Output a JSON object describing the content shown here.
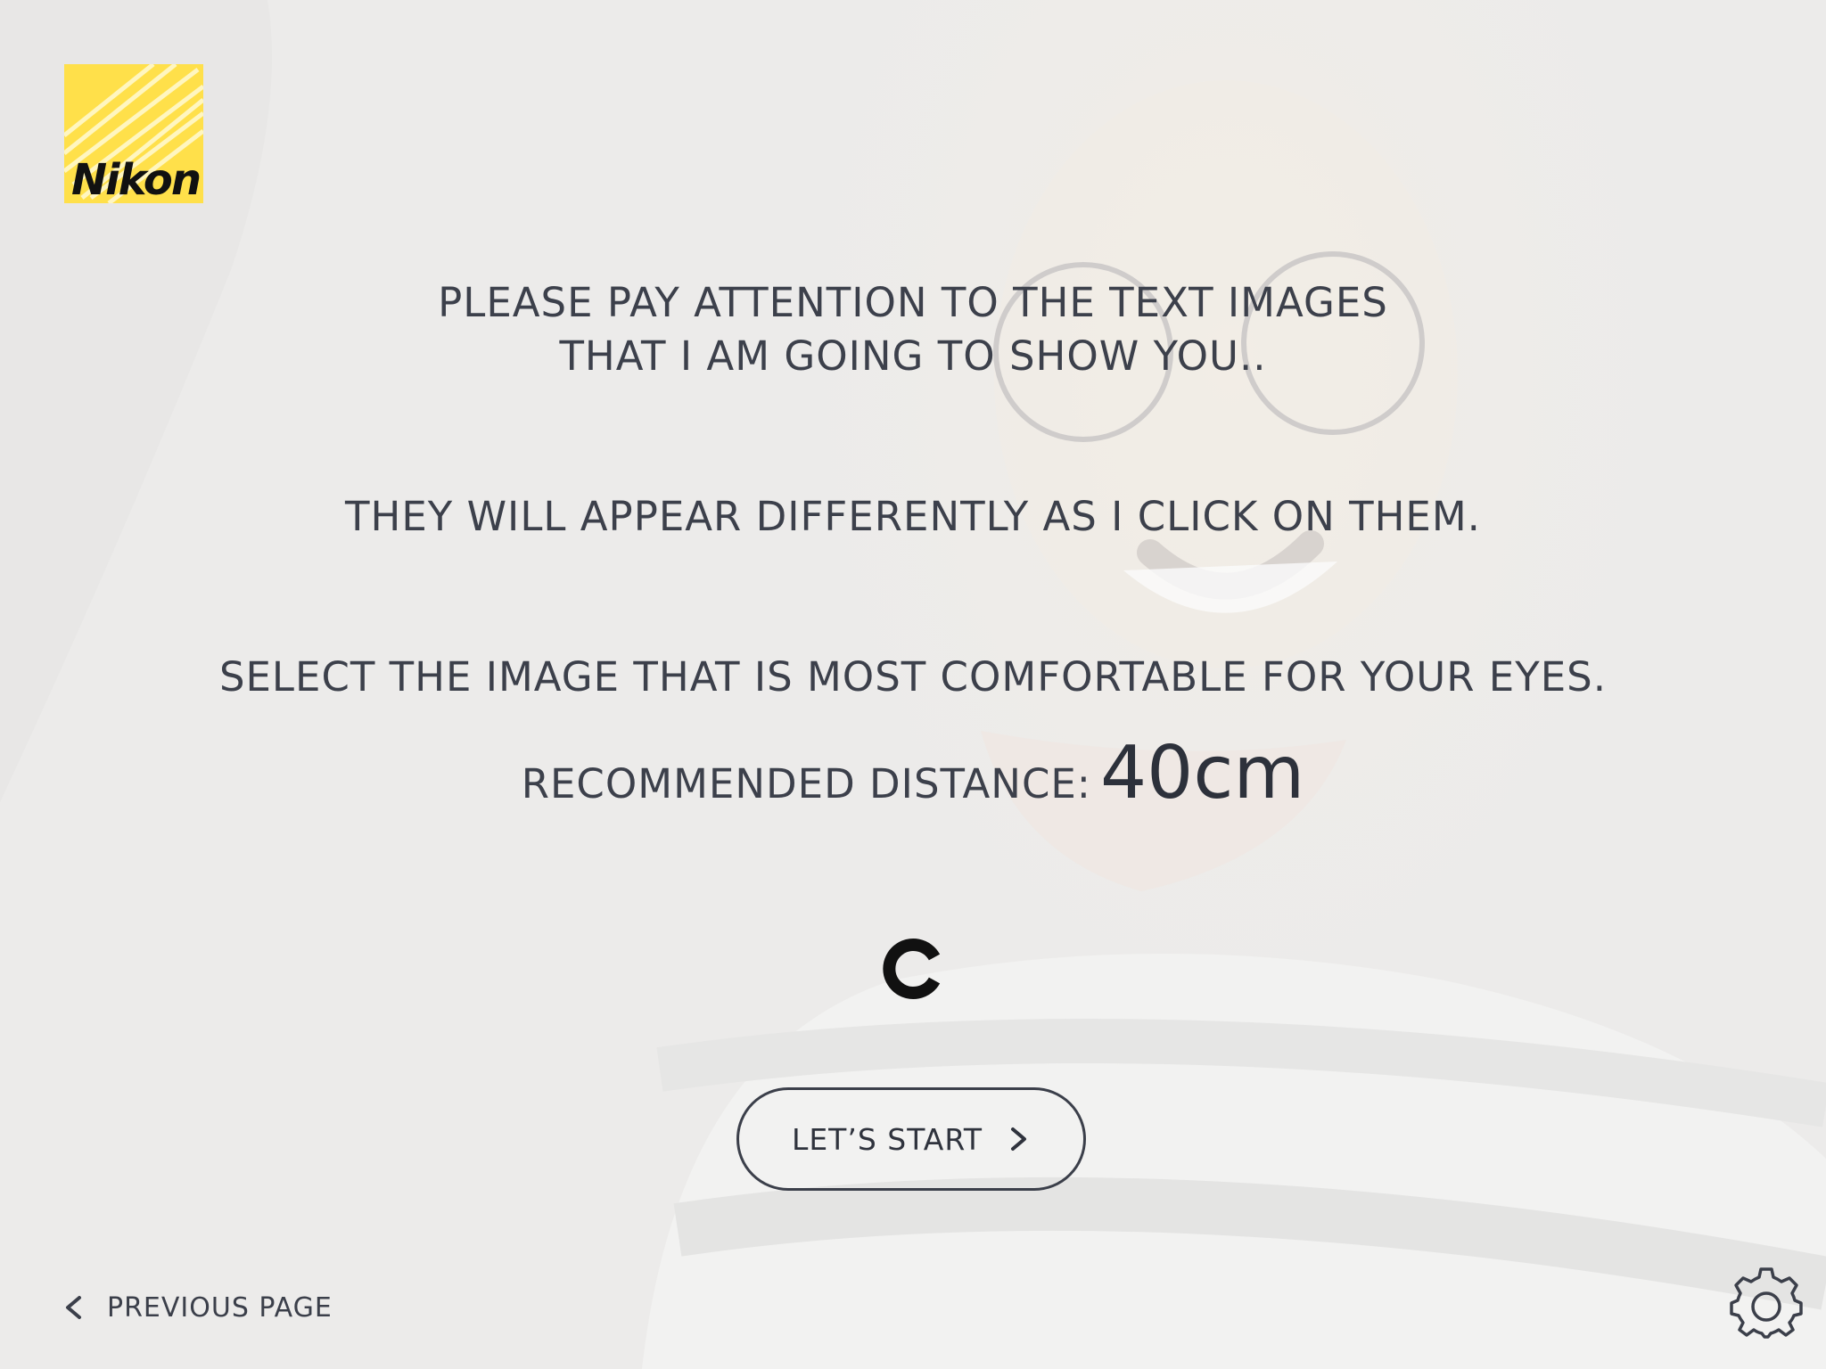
{
  "brand": {
    "logo_text": "Nikon",
    "logo_color": "#ffe04a"
  },
  "instructions": {
    "line1a": "PLEASE PAY ATTENTION TO THE TEXT IMAGES",
    "line1b": "THAT I AM GOING TO SHOW YOU..",
    "line2": "THEY WILL APPEAR DIFFERENTLY AS I CLICK ON THEM.",
    "line3": "SELECT THE IMAGE THAT IS MOST COMFORTABLE FOR YOUR EYES."
  },
  "distance": {
    "label": "RECOMMENDED DISTANCE:",
    "value": "40cm"
  },
  "optotype": {
    "icon": "landolt-c-icon"
  },
  "actions": {
    "start_label": "LET’S START",
    "previous_label": "PREVIOUS PAGE"
  },
  "icons": {
    "next": "chevron-right-icon",
    "back": "chevron-left-icon",
    "settings": "gear-icon"
  },
  "colors": {
    "text": "#3c404b",
    "background": "#ecebea"
  }
}
